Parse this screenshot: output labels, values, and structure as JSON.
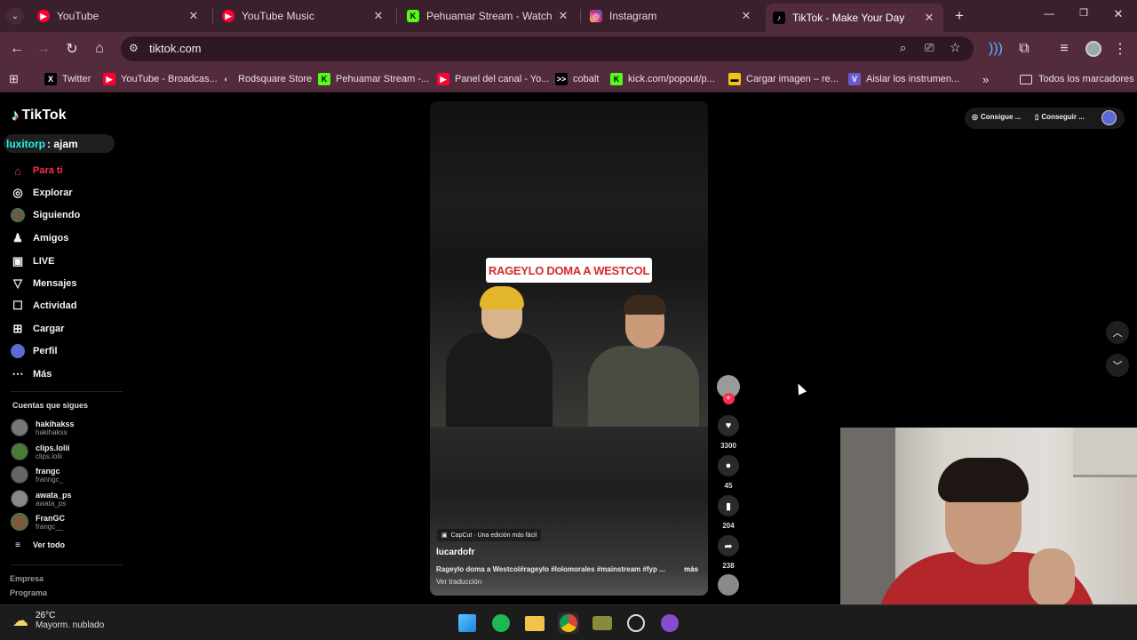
{
  "browser": {
    "tabs": [
      {
        "title": "YouTube",
        "color": "#ff0033"
      },
      {
        "title": "YouTube Music",
        "color": "#ff0033"
      },
      {
        "title": "Pehuamar Stream - Watch Live",
        "color": "#53fc18"
      },
      {
        "title": "Instagram",
        "color": "#d62976"
      },
      {
        "title": "TikTok - Make Your Day",
        "color": "#000000",
        "active": true
      }
    ],
    "url": "tiktok.com",
    "bookmarks": [
      {
        "label": "Twitter",
        "icon": "X"
      },
      {
        "label": "YouTube - Broadcas...",
        "icon": "▶"
      },
      {
        "label": "Rodsquare Store",
        "icon": "◐"
      },
      {
        "label": "Pehuamar Stream -...",
        "icon": "K"
      },
      {
        "label": "Panel del canal - Yo...",
        "icon": "▶"
      },
      {
        "label": "cobalt",
        "icon": ">>"
      },
      {
        "label": "kick.com/popout/p...",
        "icon": "K"
      },
      {
        "label": "Cargar imagen – re...",
        "icon": "▬"
      },
      {
        "label": "Aislar los instrumen...",
        "icon": "V"
      }
    ],
    "bookmarks_folder": "Todos los marcadores"
  },
  "tiktok": {
    "logo": "TikTok",
    "search_user": "luxitorp",
    "search_text": ": ajam",
    "nav": [
      {
        "label": "Para ti",
        "icon": "home-icon",
        "glyph": "⌂",
        "active": true
      },
      {
        "label": "Explorar",
        "icon": "compass-icon",
        "glyph": "◎"
      },
      {
        "label": "Siguiendo",
        "icon": "following-icon",
        "glyph": "●"
      },
      {
        "label": "Amigos",
        "icon": "friends-icon",
        "glyph": "♟"
      },
      {
        "label": "LIVE",
        "icon": "live-icon",
        "glyph": "▣"
      },
      {
        "label": "Mensajes",
        "icon": "messages-icon",
        "glyph": "▽"
      },
      {
        "label": "Actividad",
        "icon": "activity-icon",
        "glyph": "☐"
      },
      {
        "label": "Cargar",
        "icon": "upload-icon",
        "glyph": "⊞"
      },
      {
        "label": "Perfil",
        "icon": "profile-icon",
        "glyph": "●"
      },
      {
        "label": "Más",
        "icon": "more-icon",
        "glyph": "⋯"
      }
    ],
    "following_heading": "Cuentas que sigues",
    "following": [
      {
        "name": "hakihakss",
        "handle": "hakihakss"
      },
      {
        "name": "clips.lolii",
        "handle": "clips.lolii"
      },
      {
        "name": "frangc",
        "handle": "franngc_"
      },
      {
        "name": "awata_ps",
        "handle": "awata_ps"
      },
      {
        "name": "FranGC",
        "handle": "frangc__"
      }
    ],
    "see_all": "Ver todo",
    "footer": [
      "Empresa",
      "Programa"
    ],
    "top_right": [
      "Consigue ...",
      "Conseguir ..."
    ],
    "video": {
      "title_part1": "RAGEYLO DOMA A ",
      "title_part2": "WESTCOL",
      "capcut": "CapCut · Una edición más fácil",
      "author": "lucardofr",
      "description": "Rageylo doma a Westcol#rageylo #lolomorales #mainstream #fyp ...",
      "more": "más",
      "translate": "Ver traducción"
    },
    "actions": {
      "likes": "3300",
      "comments": "45",
      "saves": "204",
      "shares": "238"
    }
  },
  "taskbar": {
    "temperature": "26°C",
    "weather": "Mayorm. nublado"
  },
  "colors": {
    "accent": "#fe2c55",
    "tab_bg": "#3a1f2d",
    "toolbar_bg": "#522b3d",
    "title_red": "#d42a2a"
  }
}
